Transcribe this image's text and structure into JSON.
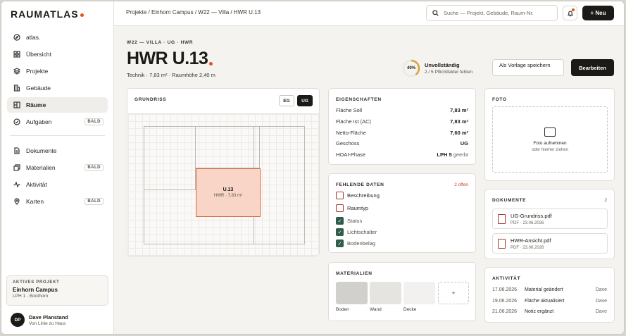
{
  "app": {
    "logo": "RAUMATLAS"
  },
  "sidebar": {
    "items": [
      {
        "label": "atlas.",
        "icon": "compass-icon"
      },
      {
        "label": "Übersicht",
        "icon": "grid-icon"
      },
      {
        "label": "Projekte",
        "icon": "layers-icon"
      },
      {
        "label": "Gebäude",
        "icon": "building-icon"
      },
      {
        "label": "Räume",
        "icon": "floorplan-icon",
        "active": true
      },
      {
        "label": "Aufgaben",
        "icon": "check-circle-icon",
        "badge": "BALD"
      }
    ],
    "items2": [
      {
        "label": "Dokumente",
        "icon": "document-icon"
      },
      {
        "label": "Materialien",
        "icon": "copy-icon",
        "badge": "BALD"
      },
      {
        "label": "Aktivität",
        "icon": "activity-icon"
      },
      {
        "label": "Karten",
        "icon": "map-pin-icon",
        "badge": "BALD"
      }
    ],
    "project": {
      "label": "AKTIVES PROJEKT",
      "name": "Einhorn Campus",
      "sub": "LPH 1 · Boothorn"
    },
    "user": {
      "initials": "DP",
      "name": "Dave Planstand",
      "role": "Von Linie zu Haus"
    }
  },
  "topbar": {
    "breadcrumb": "Projekte / Einhorn Campus / W22 — Villa / HWR U.13",
    "search_placeholder": "Suche — Projekt, Gebäude, Raum-Nr.",
    "new_label": "+ Neu"
  },
  "header": {
    "kicker": "W22 — VILLA · UG · HWR",
    "title": "HWR U.13",
    "meta": "Technik · 7,83 m² · Raumhöhe 2,40 m",
    "progress": {
      "percent_label": "40%",
      "fraction": 0.4,
      "status": "Unvollständig",
      "detail": "2 / 5 Pflichtfelder fehlen"
    },
    "template_button": "Als Vorlage speichern",
    "edit_button": "Bearbeiten"
  },
  "plan": {
    "title": "GRUNDRISS",
    "floors": [
      "EG",
      "UG"
    ],
    "active_floor": "UG",
    "room_label": "U.13",
    "room_sub": "HWR · 7,83 m²"
  },
  "properties": {
    "title": "EIGENSCHAFTEN",
    "rows": [
      {
        "label": "Fläche Soll",
        "value": "7,83 m²"
      },
      {
        "label": "Fläche Ist (AC)",
        "value": "7,83 m²"
      },
      {
        "label": "Netto-Fläche",
        "value": "7,60 m²"
      },
      {
        "label": "Geschoss",
        "value": "UG"
      },
      {
        "label": "HOAI-Phase",
        "value": "LPH 5",
        "suffix": "geerbt"
      }
    ]
  },
  "missing": {
    "title": "FEHLENDE DATEN",
    "count": "2 offen",
    "items": [
      {
        "label": "Beschreibung",
        "done": false
      },
      {
        "label": "Raumtyp",
        "done": false
      },
      {
        "label": "Status",
        "done": true
      },
      {
        "label": "Lichtschalter",
        "done": true
      },
      {
        "label": "Bodenbelag",
        "done": true
      }
    ]
  },
  "materials": {
    "title": "MATERIALIEN",
    "items": [
      {
        "label": "Boden",
        "color": "#d2d0cc"
      },
      {
        "label": "Wand",
        "color": "#e6e4e0"
      },
      {
        "label": "Decke",
        "color": "#f2f1ef"
      }
    ],
    "add": "+"
  },
  "photo": {
    "title": "FOTO",
    "primary": "Foto aufnehmen",
    "secondary": "oder hierher ziehen"
  },
  "documents": {
    "title": "DOKUMENTE",
    "count": "2",
    "items": [
      {
        "name": "UG-Grundriss.pdf",
        "meta": "PDF · 23.06.2026"
      },
      {
        "name": "HWR-Ansicht.pdf",
        "meta": "PDF · 23.06.2026"
      }
    ]
  },
  "activity": {
    "title": "AKTIVITÄT",
    "items": [
      {
        "date": "17.06.2026",
        "text": "Material geändert",
        "who": "Dave"
      },
      {
        "date": "19.06.2026",
        "text": "Fläche aktualisiert",
        "who": "Dave"
      },
      {
        "date": "21.06.2026",
        "text": "Notiz ergänzt",
        "who": "Dave"
      }
    ]
  },
  "colors": {
    "accent": "#e2501f",
    "dark": "#1c1a17",
    "check": "#2f5d4a",
    "error": "#a63b2d"
  }
}
